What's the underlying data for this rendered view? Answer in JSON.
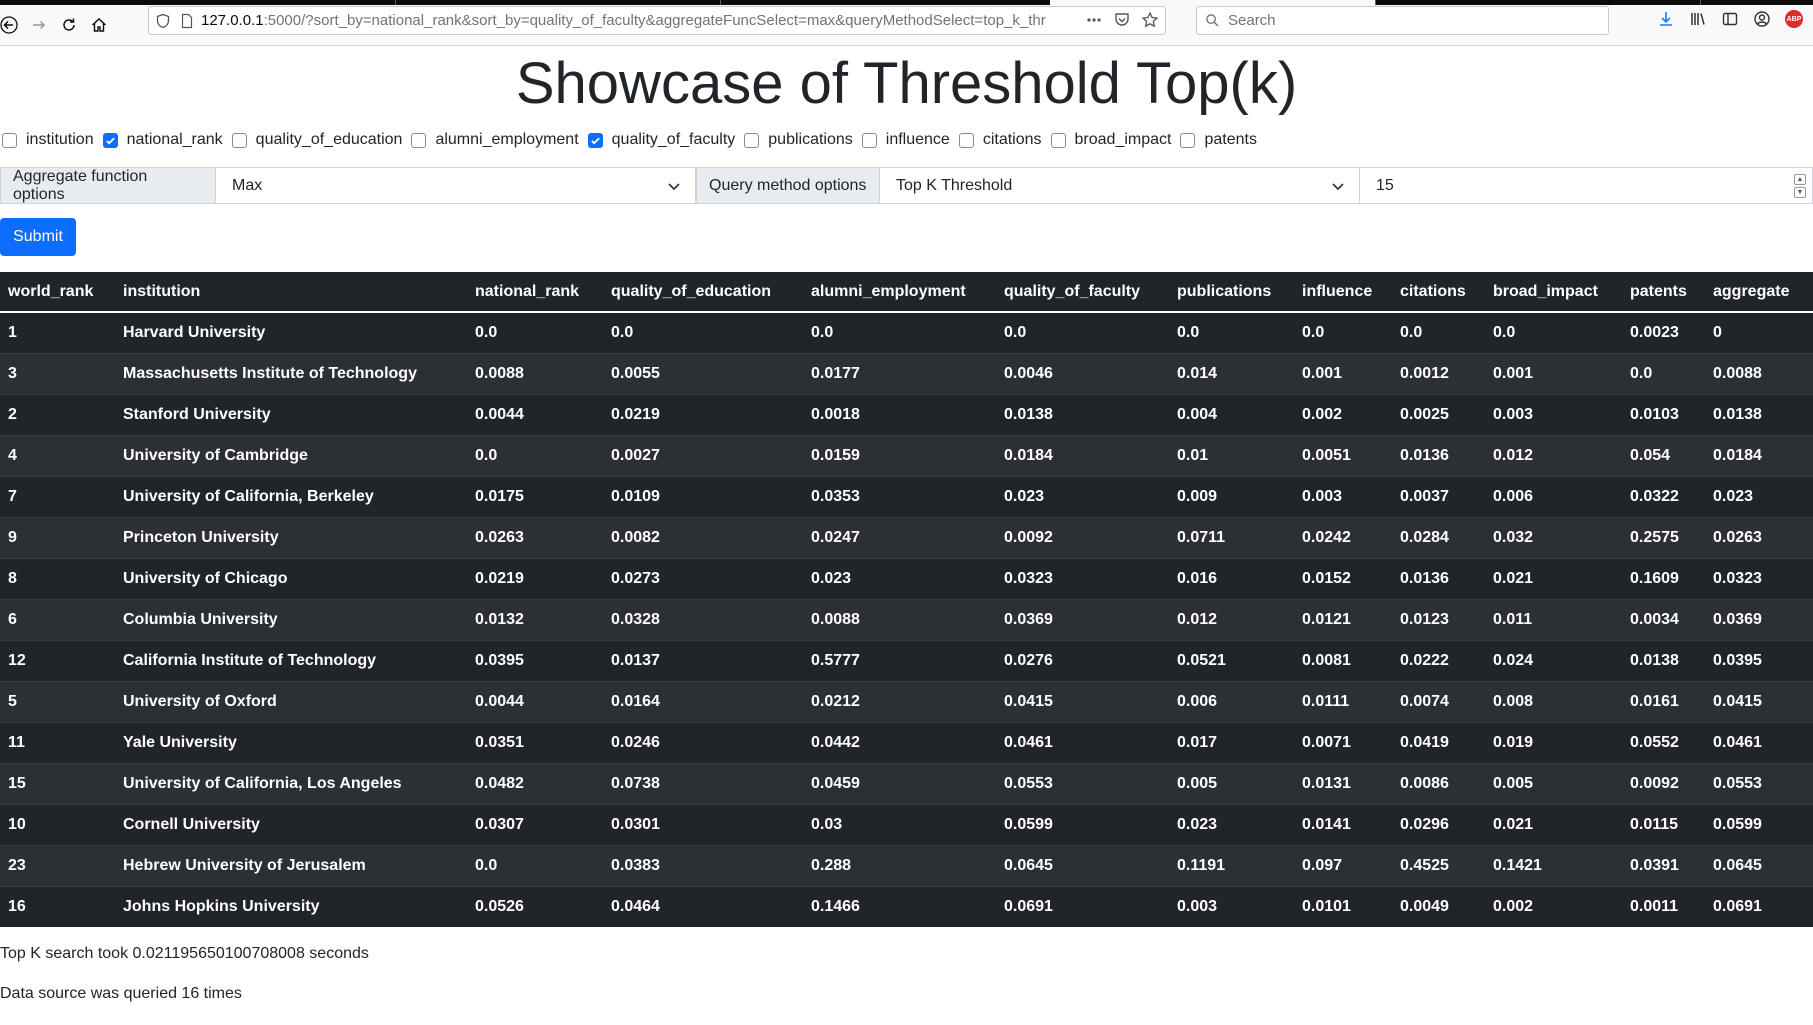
{
  "browser": {
    "url_host": "127.0.0.1",
    "url_rest": ":5000/?sort_by=national_rank&sort_by=quality_of_faculty&aggregateFuncSelect=max&queryMethodSelect=top_k_thr",
    "search_placeholder": "Search",
    "abp_label": "ABP",
    "icons": [
      "back-icon",
      "forward-icon",
      "reload-icon",
      "home-icon",
      "shield-icon",
      "page-icon",
      "more-icon",
      "pocket-icon",
      "star-icon",
      "search-icon",
      "download-icon",
      "library-icon",
      "sidebar-icon",
      "account-icon",
      "adblock-icon"
    ]
  },
  "page": {
    "title": "Showcase of Threshold Top(k)"
  },
  "checkboxes": [
    {
      "label": "institution",
      "checked": false
    },
    {
      "label": "national_rank",
      "checked": true
    },
    {
      "label": "quality_of_education",
      "checked": false
    },
    {
      "label": "alumni_employment",
      "checked": false
    },
    {
      "label": "quality_of_faculty",
      "checked": true
    },
    {
      "label": "publications",
      "checked": false
    },
    {
      "label": "influence",
      "checked": false
    },
    {
      "label": "citations",
      "checked": false
    },
    {
      "label": "broad_impact",
      "checked": false
    },
    {
      "label": "patents",
      "checked": false
    }
  ],
  "controls": {
    "aggregate_label": "Aggregate function options",
    "aggregate_value": "Max",
    "query_label": "Query method options",
    "query_value": "Top K Threshold",
    "k_value": "15"
  },
  "submit_label": "Submit",
  "table": {
    "headers": [
      "world_rank",
      "institution",
      "national_rank",
      "quality_of_education",
      "alumni_employment",
      "quality_of_faculty",
      "publications",
      "influence",
      "citations",
      "broad_impact",
      "patents",
      "aggregate"
    ],
    "rows": [
      [
        "1",
        "Harvard University",
        "0.0",
        "0.0",
        "0.0",
        "0.0",
        "0.0",
        "0.0",
        "0.0",
        "0.0",
        "0.0023",
        "0"
      ],
      [
        "3",
        "Massachusetts Institute of Technology",
        "0.0088",
        "0.0055",
        "0.0177",
        "0.0046",
        "0.014",
        "0.001",
        "0.0012",
        "0.001",
        "0.0",
        "0.0088"
      ],
      [
        "2",
        "Stanford University",
        "0.0044",
        "0.0219",
        "0.0018",
        "0.0138",
        "0.004",
        "0.002",
        "0.0025",
        "0.003",
        "0.0103",
        "0.0138"
      ],
      [
        "4",
        "University of Cambridge",
        "0.0",
        "0.0027",
        "0.0159",
        "0.0184",
        "0.01",
        "0.0051",
        "0.0136",
        "0.012",
        "0.054",
        "0.0184"
      ],
      [
        "7",
        "University of California, Berkeley",
        "0.0175",
        "0.0109",
        "0.0353",
        "0.023",
        "0.009",
        "0.003",
        "0.0037",
        "0.006",
        "0.0322",
        "0.023"
      ],
      [
        "9",
        "Princeton University",
        "0.0263",
        "0.0082",
        "0.0247",
        "0.0092",
        "0.0711",
        "0.0242",
        "0.0284",
        "0.032",
        "0.2575",
        "0.0263"
      ],
      [
        "8",
        "University of Chicago",
        "0.0219",
        "0.0273",
        "0.023",
        "0.0323",
        "0.016",
        "0.0152",
        "0.0136",
        "0.021",
        "0.1609",
        "0.0323"
      ],
      [
        "6",
        "Columbia University",
        "0.0132",
        "0.0328",
        "0.0088",
        "0.0369",
        "0.012",
        "0.0121",
        "0.0123",
        "0.011",
        "0.0034",
        "0.0369"
      ],
      [
        "12",
        "California Institute of Technology",
        "0.0395",
        "0.0137",
        "0.5777",
        "0.0276",
        "0.0521",
        "0.0081",
        "0.0222",
        "0.024",
        "0.0138",
        "0.0395"
      ],
      [
        "5",
        "University of Oxford",
        "0.0044",
        "0.0164",
        "0.0212",
        "0.0415",
        "0.006",
        "0.0111",
        "0.0074",
        "0.008",
        "0.0161",
        "0.0415"
      ],
      [
        "11",
        "Yale University",
        "0.0351",
        "0.0246",
        "0.0442",
        "0.0461",
        "0.017",
        "0.0071",
        "0.0419",
        "0.019",
        "0.0552",
        "0.0461"
      ],
      [
        "15",
        "University of California, Los Angeles",
        "0.0482",
        "0.0738",
        "0.0459",
        "0.0553",
        "0.005",
        "0.0131",
        "0.0086",
        "0.005",
        "0.0092",
        "0.0553"
      ],
      [
        "10",
        "Cornell University",
        "0.0307",
        "0.0301",
        "0.03",
        "0.0599",
        "0.023",
        "0.0141",
        "0.0296",
        "0.021",
        "0.0115",
        "0.0599"
      ],
      [
        "23",
        "Hebrew University of Jerusalem",
        "0.0",
        "0.0383",
        "0.288",
        "0.0645",
        "0.1191",
        "0.097",
        "0.4525",
        "0.1421",
        "0.0391",
        "0.0645"
      ],
      [
        "16",
        "Johns Hopkins University",
        "0.0526",
        "0.0464",
        "0.1466",
        "0.0691",
        "0.003",
        "0.0101",
        "0.0049",
        "0.002",
        "0.0011",
        "0.0691"
      ]
    ]
  },
  "stats": {
    "timing": "Top K search took 0.021195650100708008 seconds",
    "queries": "Data source was queried 16 times"
  }
}
